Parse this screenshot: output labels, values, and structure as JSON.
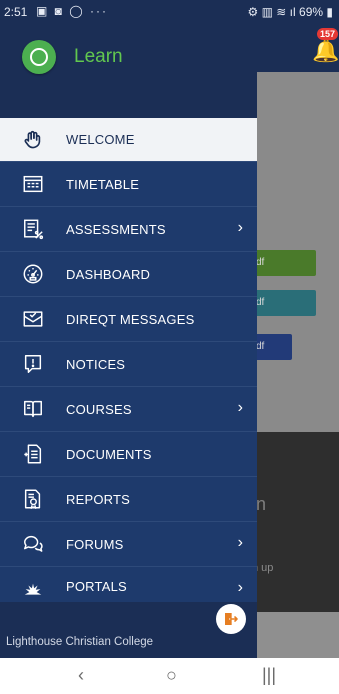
{
  "status_bar": {
    "time": "2:51",
    "left_icons": "▣ ◙ ◯ ···",
    "battery": "69%",
    "right_icons": "⚙ ▥ ≋ ıl"
  },
  "background": {
    "notification_count": "157",
    "pill1": "df",
    "pill2": "df",
    "pill3": "df",
    "dark_text1": "n",
    "dark_text2": "n up"
  },
  "drawer": {
    "app_name": "Learn",
    "items": [
      {
        "label": "WELCOME",
        "icon": "hand-wave-icon",
        "active": true
      },
      {
        "label": "TIMETABLE",
        "icon": "timetable-icon"
      },
      {
        "label": "ASSESSMENTS",
        "icon": "assessments-icon",
        "has_submenu": true
      },
      {
        "label": "DASHBOARD",
        "icon": "dashboard-gauge-icon"
      },
      {
        "label": "DIREQT MESSAGES",
        "icon": "message-envelope-icon"
      },
      {
        "label": "NOTICES",
        "icon": "notice-alert-icon"
      },
      {
        "label": "COURSES",
        "icon": "book-open-icon",
        "has_submenu": true
      },
      {
        "label": "DOCUMENTS",
        "icon": "document-icon"
      },
      {
        "label": "REPORTS",
        "icon": "report-icon"
      },
      {
        "label": "FORUMS",
        "icon": "forum-chat-icon",
        "has_submenu": true
      },
      {
        "label": "PORTALS",
        "icon": "portals-icon",
        "has_submenu": true
      }
    ],
    "chevron": "›",
    "school_name": "Lighthouse Christian College"
  },
  "nav_bar": {
    "back": "‹",
    "home": "○",
    "recents": "|||"
  },
  "colors": {
    "drawer_bg": "#1e3a6c",
    "header_bg": "#1b2e55",
    "accent_green": "#62c84f",
    "active_bg": "#f1f3f6"
  }
}
